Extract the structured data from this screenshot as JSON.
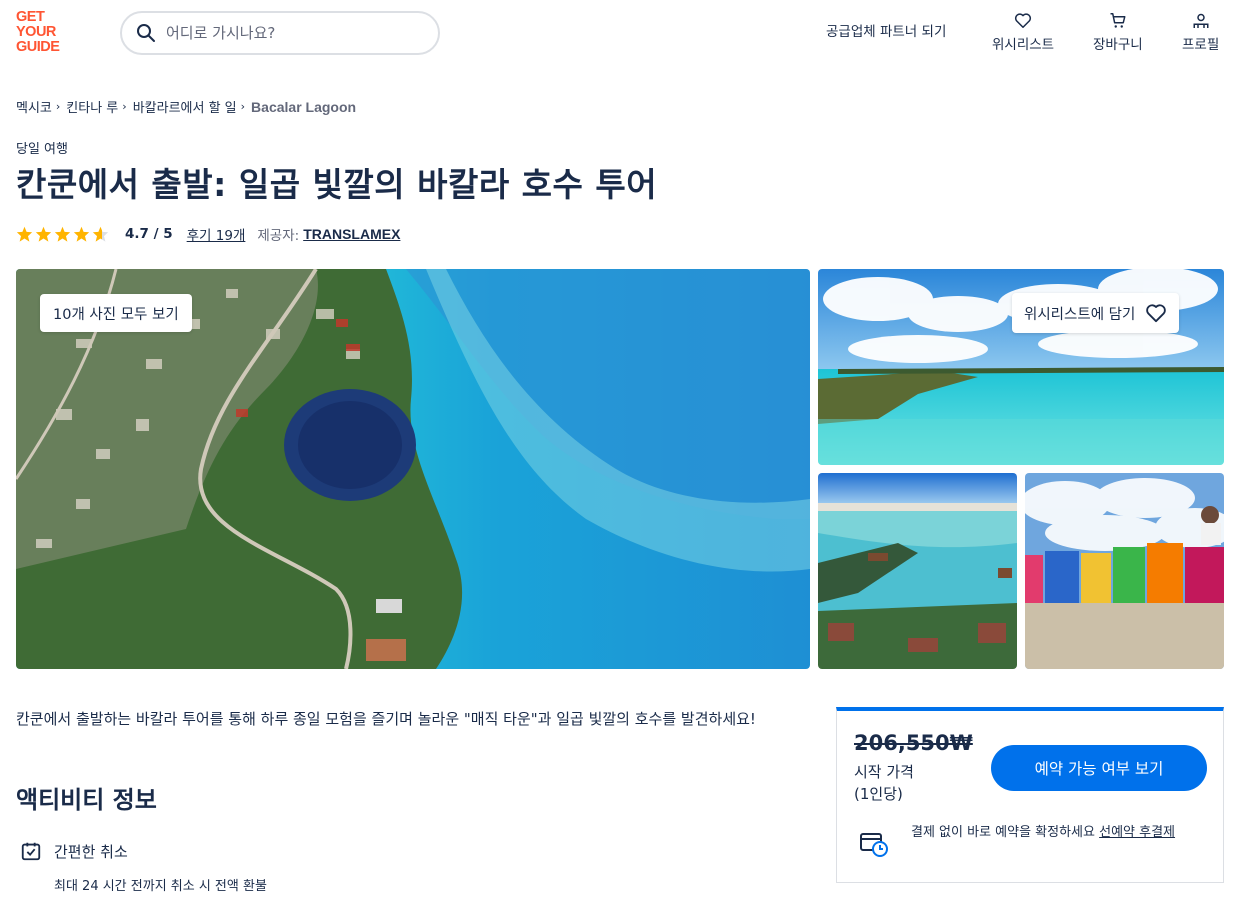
{
  "header": {
    "logo_lines": [
      "GET",
      "YOUR",
      "GUIDE"
    ],
    "search_placeholder": "어디로 가시나요?",
    "partner_link": "공급업체 파트너 되기",
    "wishlist_label": "위시리스트",
    "cart_label": "장바구니",
    "profile_label": "프로필"
  },
  "breadcrumb": [
    "멕시코",
    "킨타나 루",
    "바칼라르에서 할 일",
    "Bacalar Lagoon"
  ],
  "activity": {
    "category": "당일 여행",
    "title": "칸쿤에서 출발: 일곱 빛깔의 바칼라 호수 투어",
    "rating_value": 4.7,
    "rating_text": "4.7 / 5",
    "reviews": "후기 19개",
    "provider_label": "제공자:",
    "provider": "TRANSLAMEX"
  },
  "gallery": {
    "view_all": "10개 사진 모두 보기",
    "add_wishlist": "위시리스트에 담기"
  },
  "description": "칸쿤에서 출발하는 바칼라 투어를 통해 하루 종일 모험을 즐기며 놀라운 \"매직 타운\"과 일곱 빛깔의 호수를 발견하세요!",
  "info": {
    "section_title": "액티비티 정보",
    "cancel_title": "간편한 취소",
    "cancel_sub": "최대 24 시간 전까지 취소 시 전액 환불"
  },
  "booking": {
    "price": "206,550₩",
    "price_label_1": "시작 가격",
    "price_label_2": "(1인당)",
    "button": "예약 가능 여부 보기",
    "note": "결제 없이 바로 예약을 확정하세요",
    "note_link": "선예약 후결제"
  },
  "colors": {
    "brand": "#ff5533",
    "primary": "#0071eb",
    "text": "#1a2b49",
    "star": "#ffb400"
  }
}
